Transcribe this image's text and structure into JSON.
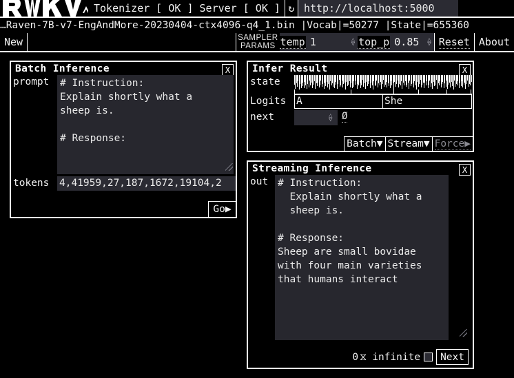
{
  "topbar": {
    "logo_text": "RWKV",
    "status": "Tokenizer [ OK ] Server [ OK ]",
    "refresh_icon": "↻",
    "url_value": "http://localhost:5000"
  },
  "model_info": "…Raven-7B-v7-EngAndMore-20230404-ctx4096-q4_1.bin |Vocab|=50277 |State|=655360",
  "toolbar": {
    "new_label": "New",
    "sampler_line1": "SAMPLER",
    "sampler_line2": "PARAMS",
    "temp_name": "temp",
    "temp_value": "1",
    "top_p_name": "top_p",
    "top_p_value": "0.85",
    "reset_label": "Reset",
    "about_label": "About"
  },
  "batch_panel": {
    "title": "Batch Inference",
    "close_label": "X",
    "prompt_label": "prompt",
    "prompt_value": "# Instruction:\nExplain shortly what a\nsheep is.\n\n# Response:",
    "tokens_label": "tokens",
    "tokens_value": "4,41959,27,187,1672,19104,2",
    "go_label": "Go▶"
  },
  "infer_panel": {
    "title": "Infer Result",
    "close_label": "X",
    "state_label": "state",
    "logits_label": "Logits",
    "logit_a": "A",
    "logit_b": "She",
    "next_label": "next",
    "next_value": "",
    "null_symbol": "Ø",
    "batch_label": "Batch▼",
    "stream_label": "Stream▼",
    "force_label": "Force▶"
  },
  "streaming_panel": {
    "title": "Streaming Inference",
    "close_label": "X",
    "out_label": "out",
    "out_value": "# Instruction:\n  Explain shortly what a\n  sheep is.\n\n# Response:\nSheep are small bovidae\nwith four main varieties\nthat humans interact",
    "count_value": "0",
    "count_icon": "⧖",
    "infinite_label": "infinite",
    "infinite_checked": false,
    "next_label": "Next"
  },
  "colors": {
    "background": "#000000",
    "foreground": "#f2f2f2",
    "field_bg": "#2b2b33",
    "textarea_bg": "#27272e",
    "disabled": "#8a8a92"
  },
  "chart_data": {
    "type": "bar",
    "title": "state",
    "xlabel": "",
    "ylabel": "",
    "note": "dense hanging-bar visualization of RWKV hidden state channels",
    "values": [
      0.62,
      0.9,
      0.55,
      0.78,
      0.42,
      0.95,
      0.6,
      0.85,
      0.5,
      0.72,
      0.88,
      0.45,
      0.66,
      0.93,
      0.58,
      0.8,
      0.37,
      0.7,
      0.52,
      0.86,
      0.63,
      0.4,
      0.91,
      0.56,
      0.74,
      0.48,
      0.82,
      0.68,
      0.35,
      0.77,
      0.6,
      0.89,
      0.5,
      0.71,
      0.44,
      0.84,
      0.59,
      0.96,
      0.41,
      0.67,
      0.53,
      0.79,
      0.87,
      0.46,
      0.64,
      0.92,
      0.57,
      0.33,
      0.75,
      0.69,
      0.38,
      0.83,
      0.61,
      0.5,
      0.94,
      0.47,
      0.73,
      0.65,
      0.39,
      0.81,
      0.54,
      0.88,
      0.43,
      0.76,
      0.62,
      0.36,
      0.9,
      0.58,
      0.7,
      0.49,
      0.85,
      0.66,
      0.34,
      0.78,
      0.55,
      0.93,
      0.45,
      0.72,
      0.6,
      0.4,
      0.86,
      0.51,
      0.68,
      0.95,
      0.42,
      0.74,
      0.63,
      0.37,
      0.8,
      0.56,
      0.69,
      0.47,
      0.91,
      0.59,
      0.32,
      0.77,
      0.64,
      0.44,
      0.82,
      0.53,
      0.71,
      0.87,
      0.38,
      0.66,
      0.5,
      0.94,
      0.46,
      0.75,
      0.61,
      0.35,
      0.83,
      0.57,
      0.7,
      0.41,
      0.89,
      0.52,
      0.67,
      0.43,
      0.79,
      0.65,
      0.48,
      0.92,
      0.36,
      0.73,
      0.6,
      0.54,
      0.84,
      0.39,
      0.68,
      0.96,
      0.45,
      0.76,
      0.58,
      0.33,
      0.81,
      0.62,
      0.49,
      0.88,
      0.51,
      0.7,
      0.4,
      0.85,
      0.64,
      0.37,
      0.78,
      0.55,
      0.93,
      0.47,
      0.72,
      0.66,
      0.34,
      0.9,
      0.56,
      0.69,
      0.42,
      0.82,
      0.6,
      0.44,
      0.87,
      0.53,
      0.75,
      0.38,
      0.91,
      0.63,
      0.5,
      0.8,
      0.46,
      0.71,
      0.95,
      0.35,
      0.77,
      0.59,
      0.67,
      0.43,
      0.86,
      0.52,
      0.74,
      0.4,
      0.83,
      0.65,
      0.48,
      0.92,
      0.57,
      0.36,
      0.79,
      0.61,
      0.7,
      0.45
    ]
  }
}
